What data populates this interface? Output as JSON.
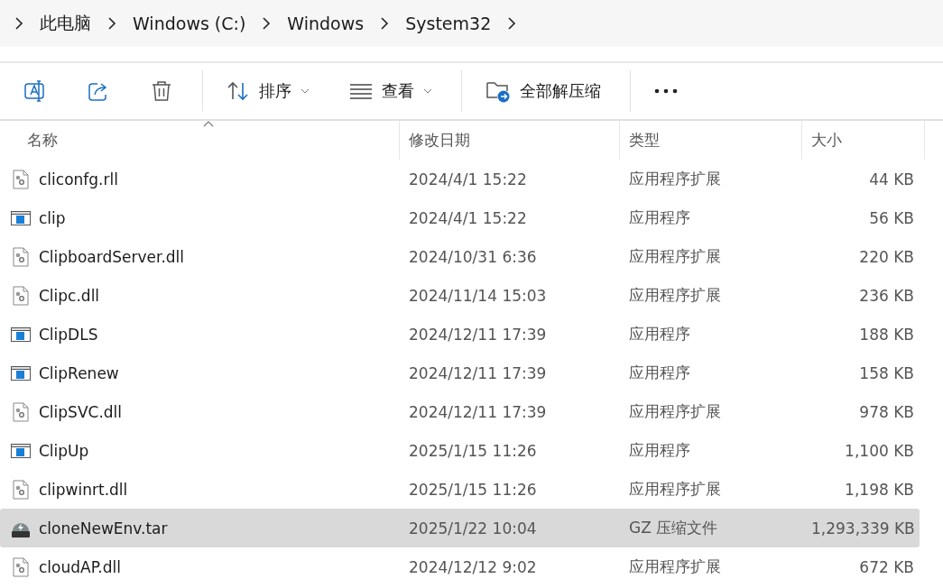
{
  "breadcrumb": [
    "此电脑",
    "Windows (C:)",
    "Windows",
    "System32"
  ],
  "toolbar": {
    "sort": "排序",
    "view": "查看",
    "extract": "全部解压缩"
  },
  "columns": [
    {
      "label": "名称",
      "sorted": true
    },
    {
      "label": "修改日期",
      "sorted": false
    },
    {
      "label": "类型",
      "sorted": false
    },
    {
      "label": "大小",
      "sorted": false
    }
  ],
  "rows": [
    {
      "kind": "dll",
      "name": "cliconfg.rll",
      "date": "2024/4/1 15:22",
      "type": "应用程序扩展",
      "size": "44 KB",
      "selected": false
    },
    {
      "kind": "exe",
      "name": "clip",
      "date": "2024/4/1 15:22",
      "type": "应用程序",
      "size": "56 KB",
      "selected": false
    },
    {
      "kind": "dll",
      "name": "ClipboardServer.dll",
      "date": "2024/10/31 6:36",
      "type": "应用程序扩展",
      "size": "220 KB",
      "selected": false
    },
    {
      "kind": "dll",
      "name": "Clipc.dll",
      "date": "2024/11/14 15:03",
      "type": "应用程序扩展",
      "size": "236 KB",
      "selected": false
    },
    {
      "kind": "exe",
      "name": "ClipDLS",
      "date": "2024/12/11 17:39",
      "type": "应用程序",
      "size": "188 KB",
      "selected": false
    },
    {
      "kind": "exe",
      "name": "ClipRenew",
      "date": "2024/12/11 17:39",
      "type": "应用程序",
      "size": "158 KB",
      "selected": false
    },
    {
      "kind": "dll",
      "name": "ClipSVC.dll",
      "date": "2024/12/11 17:39",
      "type": "应用程序扩展",
      "size": "978 KB",
      "selected": false
    },
    {
      "kind": "exe",
      "name": "ClipUp",
      "date": "2025/1/15 11:26",
      "type": "应用程序",
      "size": "1,100 KB",
      "selected": false
    },
    {
      "kind": "dll",
      "name": "clipwinrt.dll",
      "date": "2025/1/15 11:26",
      "type": "应用程序扩展",
      "size": "1,198 KB",
      "selected": false
    },
    {
      "kind": "archive",
      "name": "cloneNewEnv.tar",
      "date": "2025/1/22 10:04",
      "type": "GZ 压缩文件",
      "size": "1,293,339 KB",
      "selected": true
    },
    {
      "kind": "dll",
      "name": "cloudAP.dll",
      "date": "2024/12/12 9:02",
      "type": "应用程序扩展",
      "size": "672 KB",
      "selected": false
    }
  ]
}
